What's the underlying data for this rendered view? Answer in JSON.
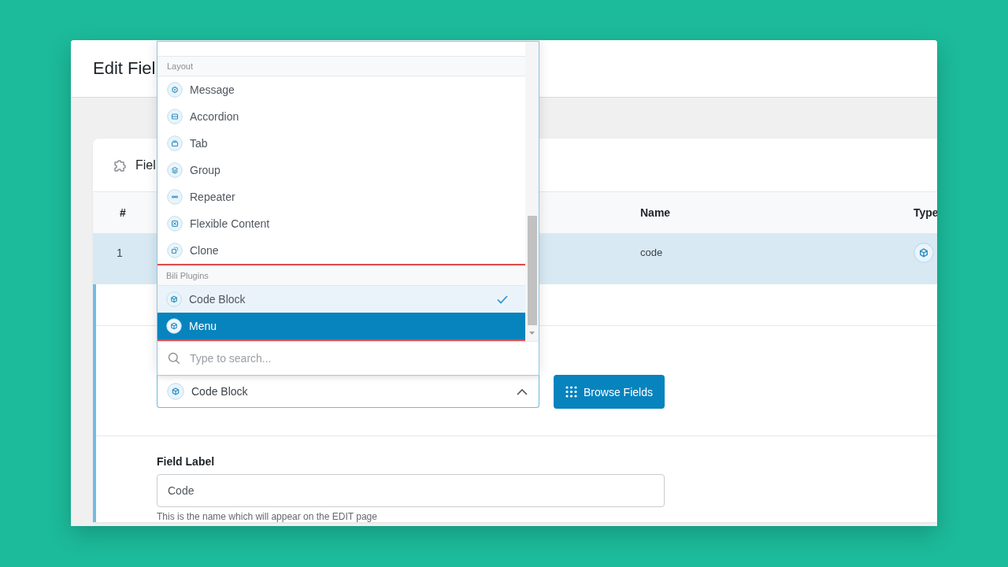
{
  "window": {
    "title": "Edit Fiel"
  },
  "fields_card": {
    "title": "Fiel",
    "table": {
      "columns": [
        "#",
        "Name",
        "Type"
      ],
      "rows": [
        {
          "number": "1",
          "name": "code",
          "selected": true
        }
      ]
    }
  },
  "field_type": {
    "value": "Code Block",
    "expanded": true,
    "search": {
      "placeholder": "Type to search..."
    },
    "groups": [
      {
        "label": "Layout",
        "options": [
          {
            "label": "Message",
            "selected": false,
            "highlighted": false
          },
          {
            "label": "Accordion",
            "selected": false,
            "highlighted": false
          },
          {
            "label": "Tab",
            "selected": false,
            "highlighted": false
          },
          {
            "label": "Group",
            "selected": false,
            "highlighted": false
          },
          {
            "label": "Repeater",
            "selected": false,
            "highlighted": false
          },
          {
            "label": "Flexible Content",
            "selected": false,
            "highlighted": false
          },
          {
            "label": "Clone",
            "selected": false,
            "highlighted": false
          }
        ]
      },
      {
        "label": "Bili Plugins",
        "outlined": true,
        "options": [
          {
            "label": "Code Block",
            "selected": true,
            "highlighted": false
          },
          {
            "label": "Menu",
            "selected": false,
            "highlighted": true
          }
        ]
      }
    ]
  },
  "browse_button": "Browse Fields",
  "field_label": {
    "label": "Field Label",
    "value": "Code",
    "help": "This is the name which will appear on the EDIT page"
  }
}
